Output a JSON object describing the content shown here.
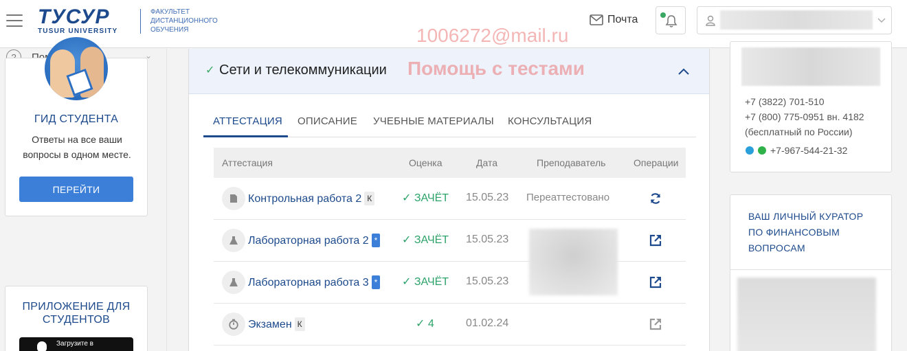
{
  "header": {
    "logo_main": "ТУСУР",
    "logo_sub": "TUSUR UNIVERSITY",
    "faculty_lines": [
      "ФАКУЛЬТЕТ",
      "ДИСТАНЦИОННОГО",
      "ОБУЧЕНИЯ"
    ],
    "mail_label": "Почта"
  },
  "watermark": {
    "line1": "1006272@mail.ru",
    "line2": "Помощь с тестами"
  },
  "sidebar": {
    "help_label": "Помощь",
    "guide": {
      "title": "ГИД СТУДЕНТА",
      "text": "Ответы на все ваши вопросы в одном месте.",
      "button": "ПЕРЕЙТИ"
    },
    "app": {
      "title": "ПРИЛОЖЕНИЕ ДЛЯ СТУДЕНТОВ",
      "store_label": "Загрузите в"
    }
  },
  "course": {
    "title": "Сети и телекоммуникации",
    "tabs": [
      "АТТЕСТАЦИЯ",
      "ОПИСАНИЕ",
      "УЧЕБНЫЕ МАТЕРИАЛЫ",
      "КОНСУЛЬТАЦИЯ"
    ],
    "active_tab": "АТТЕСТАЦИЯ",
    "columns": [
      "Аттестация",
      "Оценка",
      "Дата",
      "Преподаватель",
      "Операции"
    ],
    "rows": [
      {
        "icon": "document-icon",
        "name": "Контрольная работа 2",
        "badge": "К",
        "grade": "ЗАЧЁТ",
        "date": "15.05.23",
        "teacher": "Переаттестовано",
        "op": "refresh-icon"
      },
      {
        "icon": "flask-icon",
        "name": "Лабораторная работа 2",
        "badge": "*",
        "grade": "ЗАЧЁТ",
        "date": "15.05.23",
        "teacher": "",
        "op": "external-link-icon"
      },
      {
        "icon": "flask-icon",
        "name": "Лабораторная работа 3",
        "badge": "*",
        "grade": "ЗАЧЁТ",
        "date": "15.05.23",
        "teacher": "",
        "op": "external-link-icon"
      },
      {
        "icon": "stopwatch-icon",
        "name": "Экзамен",
        "badge": "К",
        "grade": "4",
        "date": "01.02.24",
        "teacher": "",
        "op": "external-link-icon"
      }
    ]
  },
  "contacts": {
    "phone1": "+7 (3822) 701-510",
    "phone2": "+7 (800) 775-0951 вн. 4182",
    "phone_note": "(бесплатный по России)",
    "messenger_phone": "+7-967-544-21-32"
  },
  "curator": {
    "title_lines": [
      "ВАШ ЛИЧНЫЙ КУРАТОР",
      "ПО ФИНАНСОВЫМ",
      "ВОПРОСАМ"
    ]
  },
  "colors": {
    "brand": "#1d4a8c",
    "accent": "#3b7fd9",
    "success": "#2da36a",
    "watermark": "#eb7878"
  }
}
